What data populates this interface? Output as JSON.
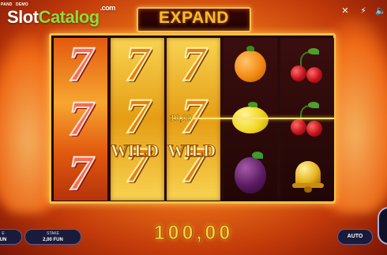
{
  "top_tags": {
    "left": "PAND",
    "right": "DEMO"
  },
  "logo": {
    "part1": "Slot",
    "part2": "Catalog",
    "sup": ".com"
  },
  "top_icons": [
    "close-icon",
    "lightning-icon",
    "volume-icon"
  ],
  "banner": {
    "text": "EXPAND"
  },
  "reels": [
    {
      "style": "fire",
      "symbols": [
        "7",
        "7",
        "7"
      ]
    },
    {
      "style": "gold",
      "symbols": [
        "7",
        "7",
        "7"
      ],
      "wild_label": "WILD"
    },
    {
      "style": "gold",
      "symbols": [
        "7",
        "7",
        "7"
      ],
      "wild_label": "WILD"
    },
    {
      "style": "dark",
      "symbols": [
        "orange",
        "lemon",
        "plum"
      ]
    },
    {
      "style": "dark",
      "symbols": [
        "cherries",
        "cherries",
        "bell"
      ]
    }
  ],
  "line_win": "10,00",
  "total_win": "100,00",
  "controls": {
    "balance": {
      "label": "E",
      "value": "UN"
    },
    "stake": {
      "label": "STAKE",
      "value": "2,00 FUN"
    },
    "auto": "AUTO"
  },
  "colors": {
    "frame": "#f1c04c",
    "win_text": "#ffd43a",
    "logo_accent": "#8fdc3a"
  }
}
